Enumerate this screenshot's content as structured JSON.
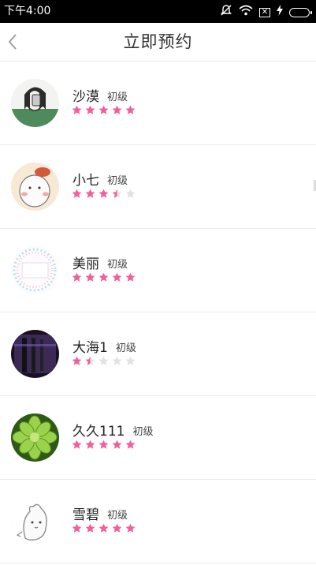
{
  "status": {
    "time": "下午4:00"
  },
  "header": {
    "title": "立即预约"
  },
  "colors": {
    "star_on": "#f25f9a",
    "star_off": "#e2e2e2"
  },
  "people": [
    {
      "name": "沙漠",
      "level": "初级",
      "rating": 5
    },
    {
      "name": "小七",
      "level": "初级",
      "rating": 3.5
    },
    {
      "name": "美丽",
      "level": "初级",
      "rating": 5
    },
    {
      "name": "大海1",
      "level": "初级",
      "rating": 1.5
    },
    {
      "name": "久久111",
      "level": "初级",
      "rating": 5
    },
    {
      "name": "雪碧",
      "level": "初级",
      "rating": 5
    }
  ]
}
